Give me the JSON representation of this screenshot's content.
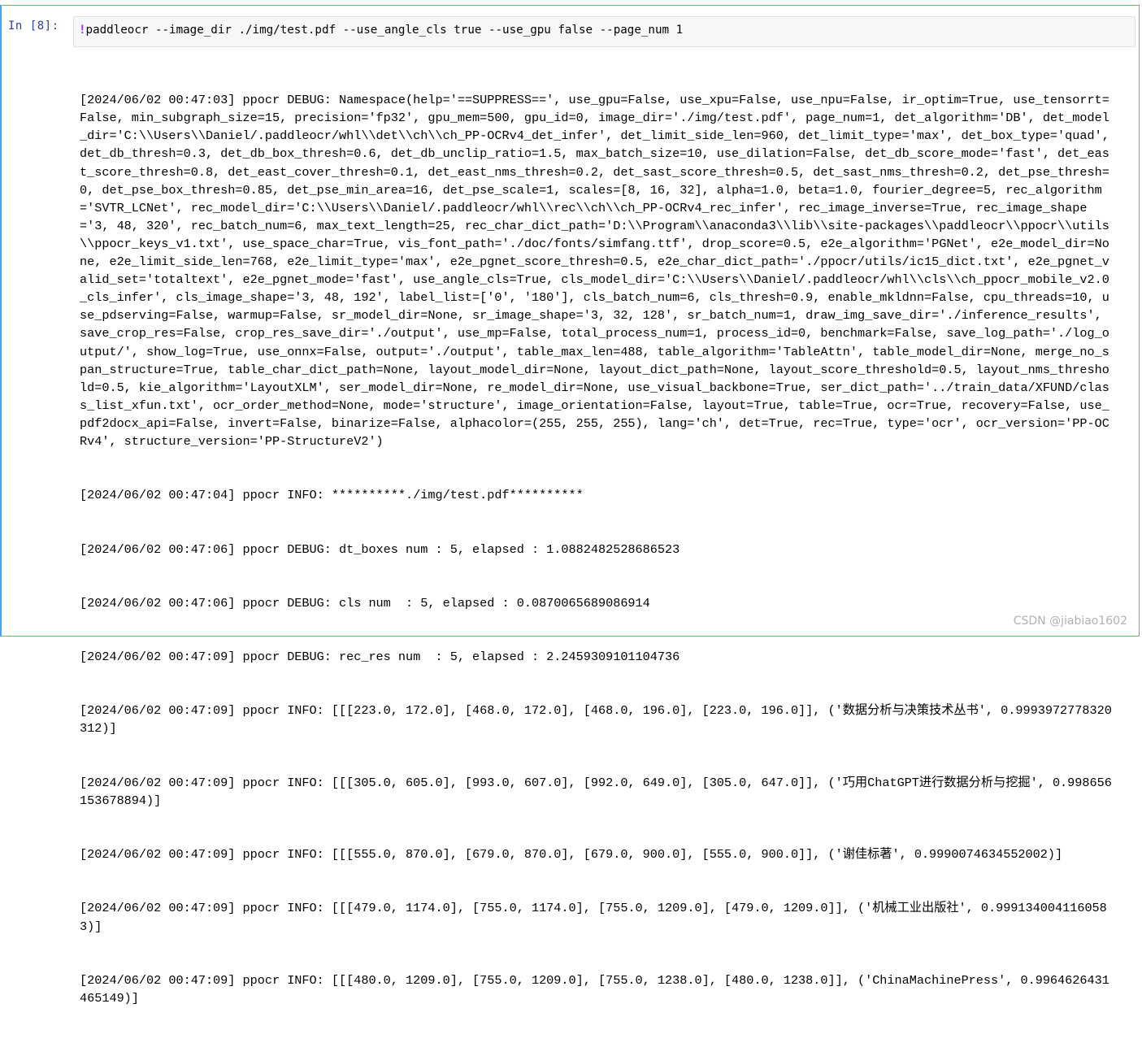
{
  "cell": {
    "prompt": "In  [8]:",
    "code": {
      "bang": "!",
      "text": "paddleocr --image_dir ./img/test.pdf --use_angle_cls true --use_gpu false --page_num 1"
    }
  },
  "output_lines": [
    "[2024/06/02 00:47:03] ppocr DEBUG: Namespace(help='==SUPPRESS==', use_gpu=False, use_xpu=False, use_npu=False, ir_optim=True, use_tensorrt=False, min_subgraph_size=15, precision='fp32', gpu_mem=500, gpu_id=0, image_dir='./img/test.pdf', page_num=1, det_algorithm='DB', det_model_dir='C:\\\\Users\\\\Daniel/.paddleocr/whl\\\\det\\\\ch\\\\ch_PP-OCRv4_det_infer', det_limit_side_len=960, det_limit_type='max', det_box_type='quad', det_db_thresh=0.3, det_db_box_thresh=0.6, det_db_unclip_ratio=1.5, max_batch_size=10, use_dilation=False, det_db_score_mode='fast', det_east_score_thresh=0.8, det_east_cover_thresh=0.1, det_east_nms_thresh=0.2, det_sast_score_thresh=0.5, det_sast_nms_thresh=0.2, det_pse_thresh=0, det_pse_box_thresh=0.85, det_pse_min_area=16, det_pse_scale=1, scales=[8, 16, 32], alpha=1.0, beta=1.0, fourier_degree=5, rec_algorithm='SVTR_LCNet', rec_model_dir='C:\\\\Users\\\\Daniel/.paddleocr/whl\\\\rec\\\\ch\\\\ch_PP-OCRv4_rec_infer', rec_image_inverse=True, rec_image_shape='3, 48, 320', rec_batch_num=6, max_text_length=25, rec_char_dict_path='D:\\\\Program\\\\anaconda3\\\\lib\\\\site-packages\\\\paddleocr\\\\ppocr\\\\utils\\\\ppocr_keys_v1.txt', use_space_char=True, vis_font_path='./doc/fonts/simfang.ttf', drop_score=0.5, e2e_algorithm='PGNet', e2e_model_dir=None, e2e_limit_side_len=768, e2e_limit_type='max', e2e_pgnet_score_thresh=0.5, e2e_char_dict_path='./ppocr/utils/ic15_dict.txt', e2e_pgnet_valid_set='totaltext', e2e_pgnet_mode='fast', use_angle_cls=True, cls_model_dir='C:\\\\Users\\\\Daniel/.paddleocr/whl\\\\cls\\\\ch_ppocr_mobile_v2.0_cls_infer', cls_image_shape='3, 48, 192', label_list=['0', '180'], cls_batch_num=6, cls_thresh=0.9, enable_mkldnn=False, cpu_threads=10, use_pdserving=False, warmup=False, sr_model_dir=None, sr_image_shape='3, 32, 128', sr_batch_num=1, draw_img_save_dir='./inference_results', save_crop_res=False, crop_res_save_dir='./output', use_mp=False, total_process_num=1, process_id=0, benchmark=False, save_log_path='./log_output/', show_log=True, use_onnx=False, output='./output', table_max_len=488, table_algorithm='TableAttn', table_model_dir=None, merge_no_span_structure=True, table_char_dict_path=None, layout_model_dir=None, layout_dict_path=None, layout_score_threshold=0.5, layout_nms_threshold=0.5, kie_algorithm='LayoutXLM', ser_model_dir=None, re_model_dir=None, use_visual_backbone=True, ser_dict_path='../train_data/XFUND/class_list_xfun.txt', ocr_order_method=None, mode='structure', image_orientation=False, layout=True, table=True, ocr=True, recovery=False, use_pdf2docx_api=False, invert=False, binarize=False, alphacolor=(255, 255, 255), lang='ch', det=True, rec=True, type='ocr', ocr_version='PP-OCRv4', structure_version='PP-StructureV2')",
    "[2024/06/02 00:47:04] ppocr INFO: **********./img/test.pdf**********",
    "[2024/06/02 00:47:06] ppocr DEBUG: dt_boxes num : 5, elapsed : 1.0882482528686523",
    "[2024/06/02 00:47:06] ppocr DEBUG: cls num  : 5, elapsed : 0.0870065689086914",
    "[2024/06/02 00:47:09] ppocr DEBUG: rec_res num  : 5, elapsed : 2.2459309101104736",
    "[2024/06/02 00:47:09] ppocr INFO: [[[223.0, 172.0], [468.0, 172.0], [468.0, 196.0], [223.0, 196.0]], ('数据分析与决策技术丛书', 0.9993972778320312)]",
    "[2024/06/02 00:47:09] ppocr INFO: [[[305.0, 605.0], [993.0, 607.0], [992.0, 649.0], [305.0, 647.0]], ('巧用ChatGPT进行数据分析与挖掘', 0.998656153678894)]",
    "[2024/06/02 00:47:09] ppocr INFO: [[[555.0, 870.0], [679.0, 870.0], [679.0, 900.0], [555.0, 900.0]], ('谢佳标著', 0.9990074634552002)]",
    "[2024/06/02 00:47:09] ppocr INFO: [[[479.0, 1174.0], [755.0, 1174.0], [755.0, 1209.0], [479.0, 1209.0]], ('机械工业出版社', 0.9991340041160583)]",
    "[2024/06/02 00:47:09] ppocr INFO: [[[480.0, 1209.0], [755.0, 1209.0], [755.0, 1238.0], [480.0, 1238.0]], ('ChinaMachinePress', 0.9964626431465149)]"
  ],
  "watermark": "CSDN @jiabiao1602",
  "colors": {
    "cell_border": "#66bb6a",
    "selected_bar": "#42a5f5",
    "prompt": "#303f9f",
    "input_bg": "#f7f7f7"
  }
}
